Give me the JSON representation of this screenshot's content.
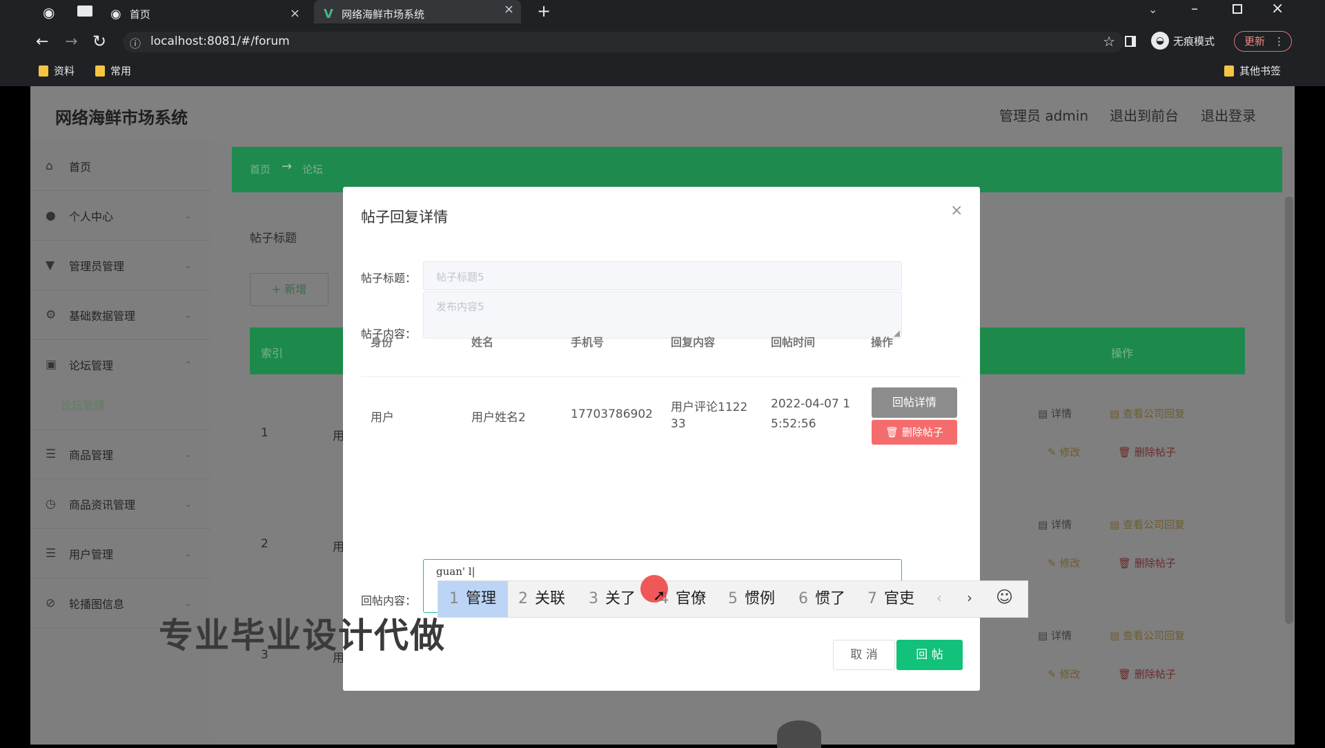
{
  "browser": {
    "tabs": [
      {
        "title": "首页"
      },
      {
        "title": "网络海鲜市场系统"
      }
    ],
    "new_tab_symbol": "+",
    "url": "localhost:8081/#/forum",
    "incognito_label": "无痕模式",
    "update_label": "更新",
    "bookmarks": [
      "资料",
      "常用"
    ],
    "other_bookmarks": "其他书签"
  },
  "header": {
    "system_title": "网络海鲜市场系统",
    "admin_label": "管理员 admin",
    "back_to_front": "退出到前台",
    "logout": "退出登录"
  },
  "sidebar": {
    "items": [
      {
        "label": "首页",
        "icon": "home-icon"
      },
      {
        "label": "个人中心",
        "icon": "user-icon"
      },
      {
        "label": "管理员管理",
        "icon": "admin-icon"
      },
      {
        "label": "基础数据管理",
        "icon": "gear-icon"
      },
      {
        "label": "论坛管理",
        "icon": "forum-icon"
      },
      {
        "label": "商品管理",
        "icon": "menu-icon"
      },
      {
        "label": "商品资讯管理",
        "icon": "clock-icon"
      },
      {
        "label": "用户管理",
        "icon": "menu-icon"
      },
      {
        "label": "轮播图信息",
        "icon": "image-icon"
      }
    ],
    "sub_item": "论坛管理"
  },
  "main": {
    "breadcrumb_home": "首页",
    "breadcrumb_arrow": "→",
    "breadcrumb_current": "论坛",
    "search_label": "帖子标题",
    "add_button": "+ 新增",
    "table_header_index": "索引",
    "table_header_actions": "操作",
    "rows": [
      {
        "index": "1",
        "prefix": "用",
        "detail": "详情",
        "reply": "查看公司回复",
        "edit": "修改",
        "delete": "删除帖子"
      },
      {
        "index": "2",
        "prefix": "用",
        "detail": "详情",
        "reply": "查看公司回复",
        "edit": "修改",
        "delete": "删除帖子"
      },
      {
        "index": "3",
        "prefix": "用",
        "detail": "详情",
        "reply": "查看公司回复",
        "edit": "修改",
        "delete": "删除帖子"
      }
    ]
  },
  "dialog": {
    "title": "帖子回复详情",
    "title_label": "帖子标题：",
    "title_placeholder": "帖子标题5",
    "content_label": "帖子内容：",
    "content_placeholder": "发布内容5",
    "columns": [
      "身份",
      "姓名",
      "手机号",
      "回复内容",
      "回帖时间",
      "操作"
    ],
    "reply_rows": [
      {
        "identity": "用户",
        "name": "用户姓名2",
        "phone": "17703786902",
        "content_line1": "用户评论1122",
        "content_line2": "33",
        "time_line1": "2022-04-07 1",
        "time_line2": "5:52:56",
        "detail_button": "回帖详情",
        "delete_button": "删除帖子"
      }
    ],
    "reply_label": "回帖内容：",
    "reply_value": "guan' l|",
    "cancel_button": "取 消",
    "submit_button": "回 帖"
  },
  "ime": {
    "candidates": [
      {
        "n": "1",
        "w": "管理"
      },
      {
        "n": "2",
        "w": "关联"
      },
      {
        "n": "3",
        "w": "关了"
      },
      {
        "n": "4",
        "w": "官僚"
      },
      {
        "n": "5",
        "w": "惯例"
      },
      {
        "n": "6",
        "w": "惯了"
      },
      {
        "n": "7",
        "w": "官吏"
      }
    ]
  },
  "watermark": "专业毕业设计代做"
}
